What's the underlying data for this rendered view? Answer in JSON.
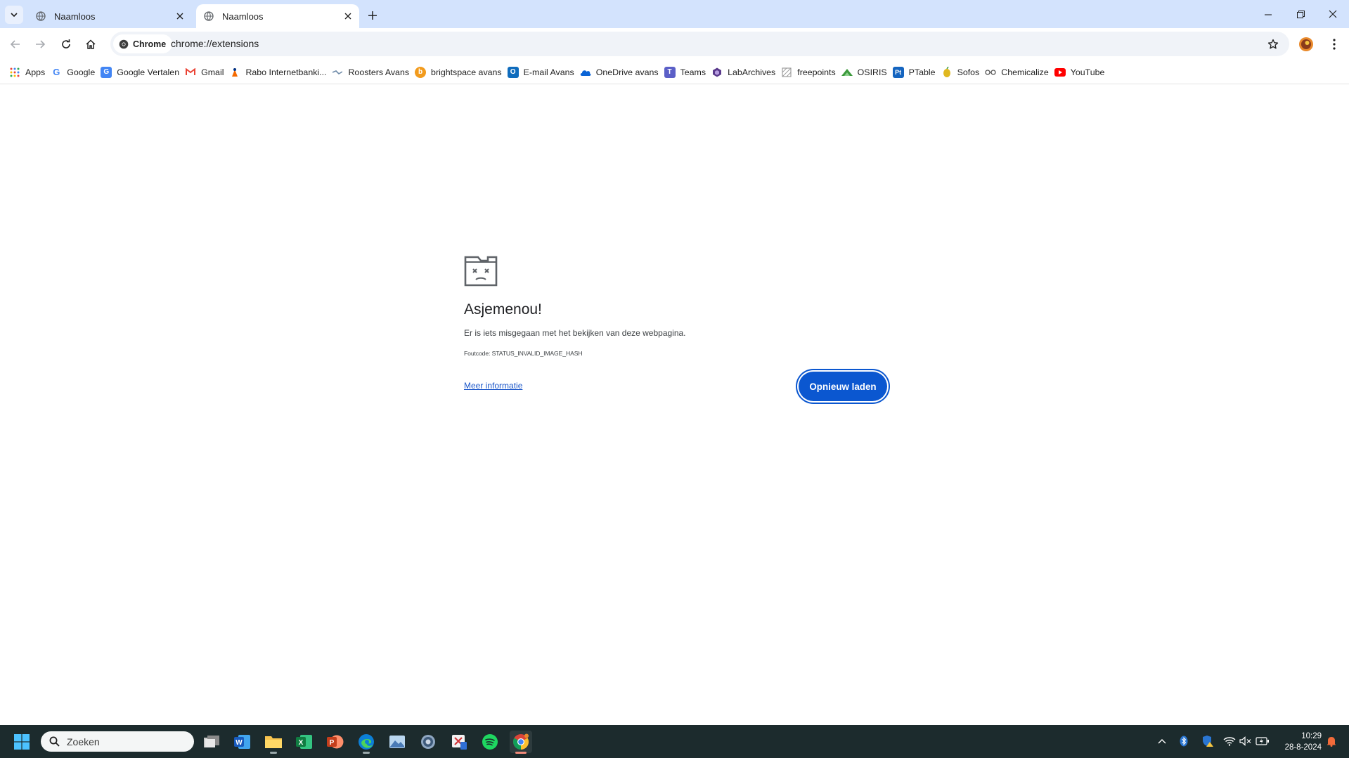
{
  "browser": {
    "tabs": [
      {
        "title": "Naamloos",
        "active": false
      },
      {
        "title": "Naamloos",
        "active": true
      }
    ],
    "omnibox": {
      "chip_label": "Chrome",
      "url": "chrome://extensions"
    }
  },
  "bookmarks": [
    {
      "label": "Apps",
      "icon": "apps-grid-icon",
      "color": "#e8453c"
    },
    {
      "label": "Google",
      "icon": "google-icon",
      "color": "#4285f4"
    },
    {
      "label": "Google Vertalen",
      "icon": "google-translate-icon",
      "color": "#4285f4"
    },
    {
      "label": "Gmail",
      "icon": "gmail-icon",
      "color": "#ea4335"
    },
    {
      "label": "Rabo Internetbanki...",
      "icon": "rabobank-icon",
      "color": "#f56a00"
    },
    {
      "label": "Roosters Avans",
      "icon": "roosters-icon",
      "color": "#6e8aa8"
    },
    {
      "label": "brightspace avans",
      "icon": "brightspace-icon",
      "color": "#f29b1d"
    },
    {
      "label": "E-mail Avans",
      "icon": "outlook-icon",
      "color": "#0f6cbd"
    },
    {
      "label": "OneDrive avans",
      "icon": "onedrive-icon",
      "color": "#0a64d6"
    },
    {
      "label": "Teams",
      "icon": "teams-icon",
      "color": "#5b5fc7"
    },
    {
      "label": "LabArchives",
      "icon": "labarchives-icon",
      "color": "#5a3a8c"
    },
    {
      "label": "freepoints",
      "icon": "freepoints-icon",
      "color": "#9e9e9e"
    },
    {
      "label": "OSIRIS",
      "icon": "osiris-icon",
      "color": "#3c9a3c"
    },
    {
      "label": "PTable",
      "icon": "ptable-icon",
      "color": "#1565c0"
    },
    {
      "label": "Sofos",
      "icon": "sofos-icon",
      "color": "#e0b820"
    },
    {
      "label": "Chemicalize",
      "icon": "chemicalize-icon",
      "color": "#555555"
    },
    {
      "label": "YouTube",
      "icon": "youtube-icon",
      "color": "#ff0000"
    }
  ],
  "error_page": {
    "title": "Asjemenou!",
    "description": "Er is iets misgegaan met het bekijken van deze webpagina.",
    "error_code": "Foutcode: STATUS_INVALID_IMAGE_HASH",
    "more_info_link": "Meer informatie",
    "reload_button": "Opnieuw laden"
  },
  "taskbar": {
    "search_placeholder": "Zoeken",
    "time": "10:29",
    "date": "28-8-2024",
    "apps": [
      "task-view",
      "word",
      "file-explorer",
      "excel",
      "powerpoint",
      "edge",
      "photos",
      "settings",
      "snipping-tool",
      "spotify",
      "chrome"
    ]
  },
  "colors": {
    "tabstrip": "#d3e3fd",
    "accent": "#0b57d0",
    "taskbar": "#1c2b2d"
  }
}
